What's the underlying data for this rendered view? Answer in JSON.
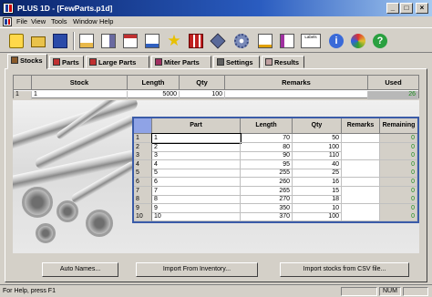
{
  "window": {
    "title": "PLUS 1D - [FewParts.p1d]"
  },
  "menu": [
    "File",
    "View",
    "Tools",
    "Window",
    "Help"
  ],
  "toolbar": {
    "icons": [
      "new-file-icon",
      "open-folder-icon",
      "save-icon",
      "print-preview-icon",
      "settings-wrench-icon",
      "checklist-icon",
      "edit-icon",
      "star-icon",
      "parts-grid-icon",
      "tag-icon",
      "gear-icon",
      "document-icon",
      "report-icon",
      "labels-icon",
      "info-icon",
      "palette-icon",
      "help-icon"
    ],
    "labels_text": "Labels"
  },
  "tabs": [
    {
      "label": "Stocks",
      "active": true
    },
    {
      "label": "Parts"
    },
    {
      "label": "Large Parts"
    },
    {
      "label": "Miter Parts"
    },
    {
      "label": "Settings"
    },
    {
      "label": "Results"
    }
  ],
  "stocks": {
    "columns": [
      "Stock",
      "Length",
      "Qty",
      "Remarks",
      "Used"
    ],
    "rows": [
      {
        "n": "1",
        "stock": "1",
        "length": "5000",
        "qty": "100",
        "remarks": "",
        "used": "26"
      }
    ]
  },
  "parts": {
    "columns": [
      "Part",
      "Length",
      "Qty",
      "Remarks",
      "Remaining"
    ],
    "rows": [
      {
        "n": "1",
        "part": "1",
        "length": "70",
        "qty": "50",
        "remaining": "0"
      },
      {
        "n": "2",
        "part": "2",
        "length": "80",
        "qty": "100",
        "remaining": "0"
      },
      {
        "n": "3",
        "part": "3",
        "length": "90",
        "qty": "110",
        "remaining": "0"
      },
      {
        "n": "4",
        "part": "4",
        "length": "95",
        "qty": "40",
        "remaining": "0"
      },
      {
        "n": "5",
        "part": "5",
        "length": "255",
        "qty": "25",
        "remaining": "0"
      },
      {
        "n": "6",
        "part": "6",
        "length": "260",
        "qty": "16",
        "remaining": "0"
      },
      {
        "n": "7",
        "part": "7",
        "length": "265",
        "qty": "15",
        "remaining": "0"
      },
      {
        "n": "8",
        "part": "8",
        "length": "270",
        "qty": "18",
        "remaining": "0"
      },
      {
        "n": "9",
        "part": "9",
        "length": "350",
        "qty": "10",
        "remaining": "0"
      },
      {
        "n": "10",
        "part": "10",
        "length": "370",
        "qty": "100",
        "remaining": "0"
      }
    ]
  },
  "buttons": {
    "auto_names": "Auto Names...",
    "import_inventory": "Import From Inventory...",
    "import_csv": "Import stocks from CSV file..."
  },
  "status": {
    "help": "For Help, press F1",
    "num": "NUM"
  },
  "colors": {
    "title_start": "#0a246a",
    "title_end": "#a6caf0",
    "remaining_text": "#1a8a1a",
    "parts_border": "#3a5ba8"
  }
}
